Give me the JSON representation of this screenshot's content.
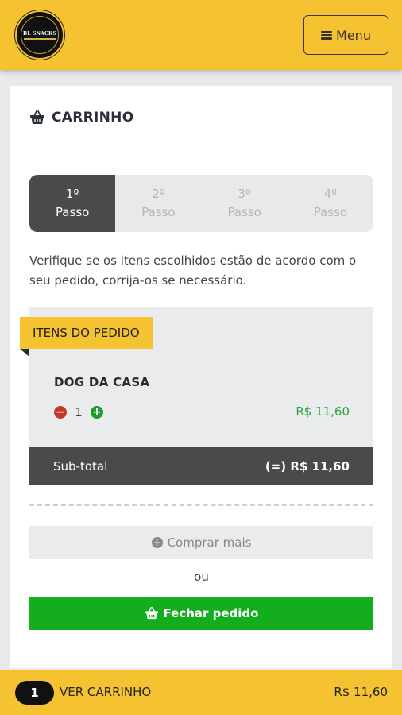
{
  "header": {
    "logo_text": "BL SNACKS",
    "menu_label": "Menu"
  },
  "cart": {
    "title": "CARRINHO",
    "steps": [
      {
        "number": "1º",
        "label": "Passo",
        "active": true
      },
      {
        "number": "2º",
        "label": "Passo",
        "active": false
      },
      {
        "number": "3º",
        "label": "Passo",
        "active": false
      },
      {
        "number": "4º",
        "label": "Passo",
        "active": false
      }
    ],
    "intro": "Verifique se os itens escolhidos estão de acordo com o seu pedido, corrija-os se necessário.",
    "section_label": "ITENS DO PEDIDO",
    "items": [
      {
        "name": "DOG DA CASA",
        "quantity": "1",
        "price": "R$ 11,60"
      }
    ],
    "subtotal_label": "Sub-total",
    "subtotal_value": "(=) R$ 11,60",
    "buy_more_label": "Comprar mais",
    "or_label": "ou",
    "checkout_label": "Fechar pedido"
  },
  "bottom_bar": {
    "count": "1",
    "view_cart_label": "VER CARRINHO",
    "total": "R$ 11,60"
  },
  "colors": {
    "brand_yellow": "#f5c232",
    "active_step": "#4a4a4a",
    "checkout_green": "#14ad1d",
    "price_green": "#2fa33c",
    "minus_red": "#c0392b"
  }
}
